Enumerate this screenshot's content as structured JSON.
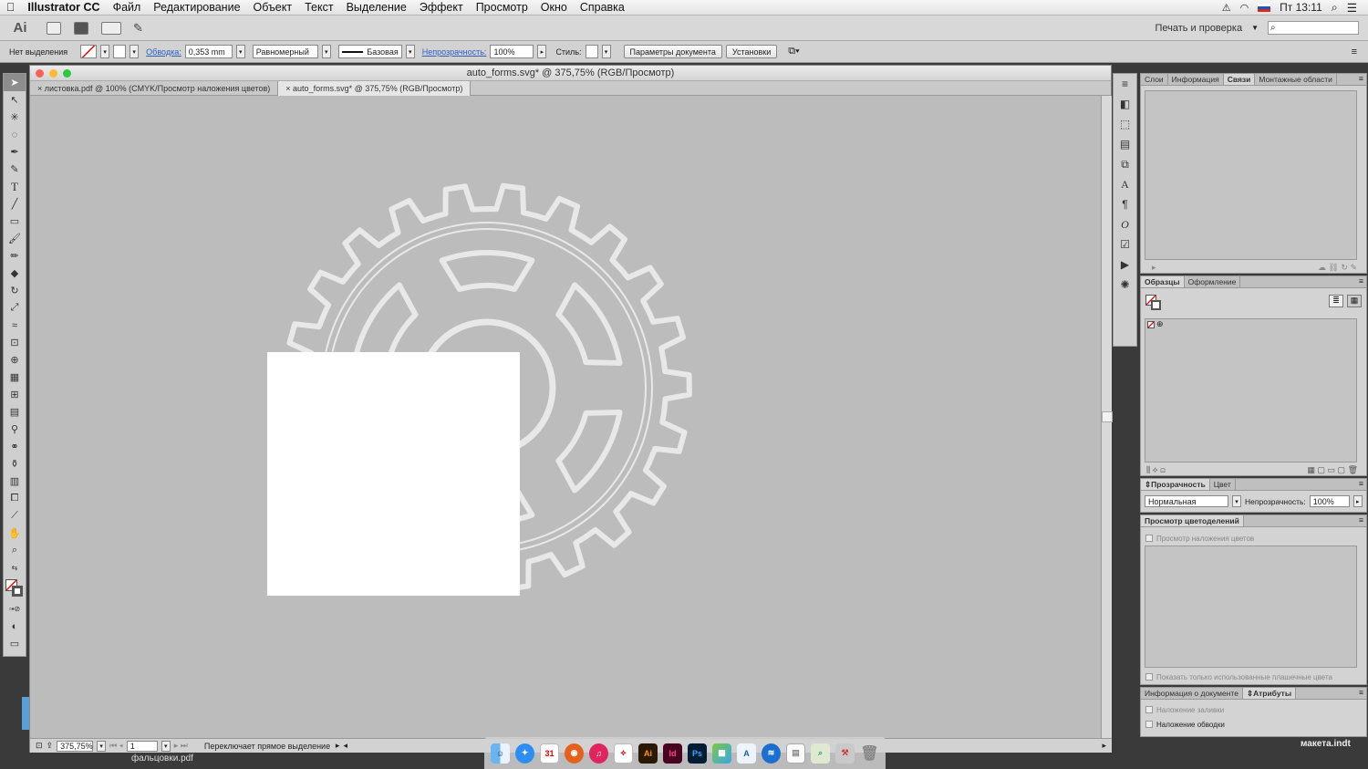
{
  "menubar": {
    "app": "Illustrator CC",
    "items": [
      "Файл",
      "Редактирование",
      "Объект",
      "Текст",
      "Выделение",
      "Эффект",
      "Просмотр",
      "Окно",
      "Справка"
    ],
    "clock": "Пт 13:11"
  },
  "appbar": {
    "logo": "Ai",
    "workspace": "Печать и проверка",
    "search_glyph": "⌕"
  },
  "control": {
    "no_selection": "Нет выделения",
    "stroke_label": "Обводка:",
    "stroke_value": "0,353 mm",
    "stroke_profile": "Равномерный",
    "brush": "Базовая",
    "opacity_label": "Непрозрачность:",
    "opacity_value": "100%",
    "style_label": "Стиль:",
    "doc_setup": "Параметры документа",
    "prefs": "Установки"
  },
  "document": {
    "title": "auto_forms.svg* @ 375,75% (RGB/Просмотр)",
    "tabs": [
      {
        "label": "листовка.pdf @ 100% (CMYK/Просмотр наложения цветов)",
        "active": false
      },
      {
        "label": "auto_forms.svg* @ 375,75% (RGB/Просмотр)",
        "active": true
      }
    ],
    "zoom": "375,75%",
    "artboard": "1",
    "status": "Переключает прямое выделение"
  },
  "panels": {
    "links_tabs": [
      "Слои",
      "Информация",
      "Связи",
      "Монтажные области"
    ],
    "links_active": 2,
    "swatches_tabs": [
      "Образцы",
      "Оформление"
    ],
    "transparency_tabs": [
      "Прозрачность",
      "Цвет"
    ],
    "blend_mode": "Нормальная",
    "opacity_label": "Непрозрачность:",
    "opacity_value": "100%",
    "separations_tab": "Просмотр цветоделений",
    "overprint_preview": "Просмотр наложения цветов",
    "show_used_only": "Показать только использованные плашечные цвета",
    "docinfo_tabs": [
      "Информация о документе",
      "Атрибуты"
    ],
    "fill_overprint": "Наложение заливки",
    "stroke_overprint": "Наложение обводки"
  },
  "dock": [
    "Finder",
    "Safari",
    "Calendar",
    "Firefox",
    "iTunes",
    "Acrobat",
    "Ai",
    "Id",
    "Ps",
    "Maps",
    "Dictionary",
    "Xcode",
    "Preview",
    "Search",
    "Utilities",
    "Trash"
  ],
  "desktop": {
    "file_left": "фальцовки.pdf",
    "file_right": "макета.indt"
  },
  "colors": {
    "canvas": "#bcbcbc",
    "gear": "#e8e8e8",
    "rect": "#ffffff"
  }
}
